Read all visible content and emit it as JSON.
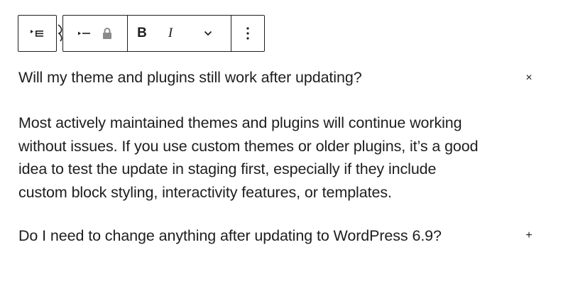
{
  "toolbar": {
    "group1": {
      "icon": "list-outdent-icon"
    },
    "group2": {
      "items": [
        {
          "icon": "list-indent-icon"
        },
        {
          "icon": "lock-icon"
        }
      ],
      "bold_label": "B",
      "italic_label": "I",
      "more_icon": "chevron-down-icon",
      "options_icon": "vertical-ellipsis-icon"
    }
  },
  "faq": {
    "items": [
      {
        "question": "Will my theme and plugins still work after updating?",
        "toggle": "×",
        "expanded": true,
        "answer_lines": [
          "Most actively maintained themes and plugins will continue working",
          "without issues. If you use custom themes or older plugins, it’s a good",
          "idea to test the update in staging first, especially if they include",
          "custom block styling, interactivity features, or templates."
        ]
      },
      {
        "question": "Do I need to change anything after updating to WordPress 6.9?",
        "toggle": "+",
        "expanded": false
      }
    ]
  }
}
